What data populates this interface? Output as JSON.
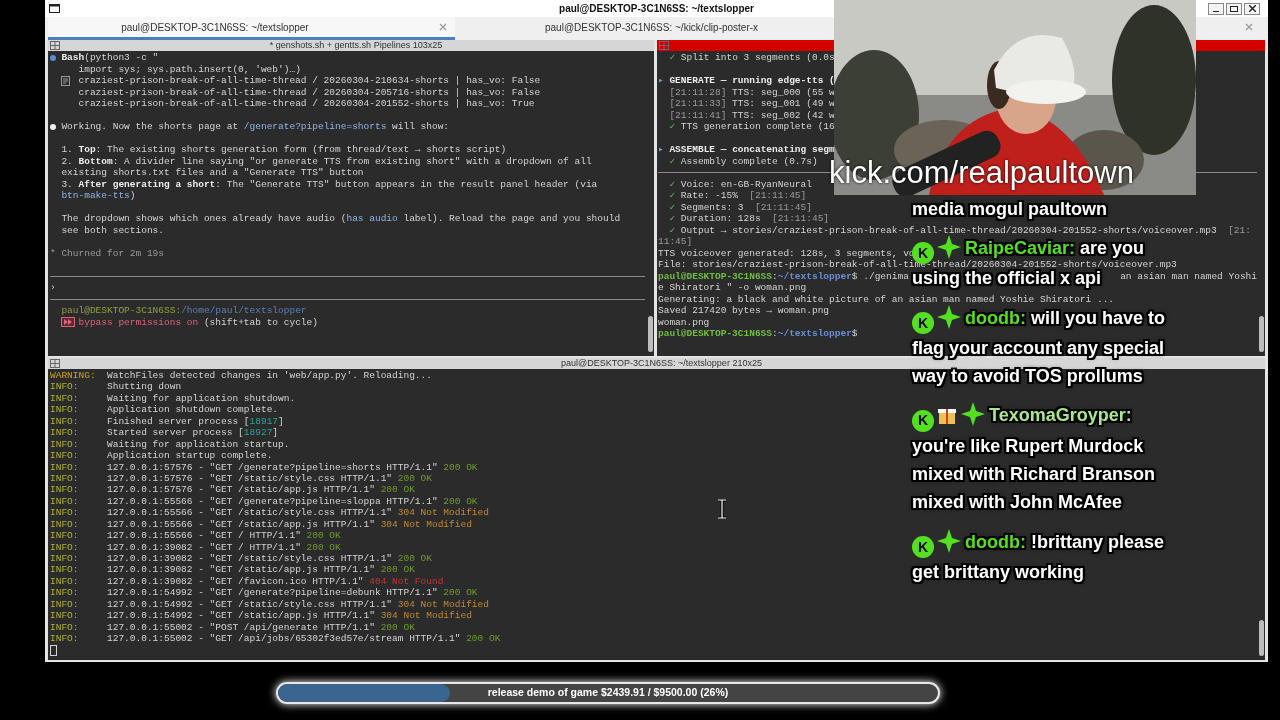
{
  "window": {
    "title": "paul@DESKTOP-3C1N6SS: ~/textslopper"
  },
  "tabs": [
    {
      "label": "paul@DESKTOP-3C1N6SS: ~/textslopper",
      "selected": true
    },
    {
      "label": "paul@DESKTOP-3C1N6SS: ~/kick/clip-poster-x",
      "selected": false
    },
    {
      "selected": false
    }
  ],
  "left_pane": {
    "title": "* genshots.sh + gentts.sh Pipelines 103x25",
    "activity": false,
    "lines": [
      {
        "kind": "text",
        "marker": {
          "kind": "dot",
          "color": "#5b8dd6"
        },
        "segments": [
          {
            "text": "Bash",
            "kind": "bold"
          },
          {
            "text": "(python3 -c \"",
            "kind": "plain"
          }
        ]
      },
      {
        "kind": "text",
        "segments": [
          {
            "text": "   import sys; sys.path.insert(0, 'web')…)",
            "kind": "plain"
          }
        ]
      },
      {
        "kind": "text",
        "marker": {
          "kind": "result"
        },
        "segments": [
          {
            "text": "craziest-prison-break-of-all-time-thread / 20260304-210634-shorts | has_vo: False",
            "kind": "plain"
          }
        ]
      },
      {
        "kind": "text",
        "segments": [
          {
            "text": "   craziest-prison-break-of-all-time-thread / 20260304-205716-shorts | has_vo: False",
            "kind": "plain"
          }
        ]
      },
      {
        "kind": "text",
        "segments": [
          {
            "text": "   craziest-prison-break-of-all-time-thread / 20260304-201552-shorts | has_vo: True",
            "kind": "plain"
          }
        ]
      },
      {
        "kind": "blank"
      },
      {
        "kind": "text",
        "marker": {
          "kind": "dot",
          "color": "#f0f0f0"
        },
        "segments": [
          {
            "text": "Working. Now the shorts page at ",
            "kind": "plain"
          },
          {
            "text": "/generate?pipeline=shorts",
            "kind": "link"
          },
          {
            "text": " will show:",
            "kind": "plain"
          }
        ]
      },
      {
        "kind": "blank"
      },
      {
        "kind": "text",
        "segments": [
          {
            "text": "1. ",
            "kind": "plain"
          },
          {
            "text": "Top",
            "kind": "bold"
          },
          {
            "text": ": The existing shorts generation form (from thread/text → shorts script)",
            "kind": "plain"
          }
        ]
      },
      {
        "kind": "text",
        "segments": [
          {
            "text": "2. ",
            "kind": "plain"
          },
          {
            "text": "Bottom",
            "kind": "bold"
          },
          {
            "text": ": A divider line saying \"or generate TTS from existing short\" with a dropdown of all",
            "kind": "plain"
          }
        ]
      },
      {
        "kind": "text",
        "segments": [
          {
            "text": "existing shorts.txt files and a \"Generate TTS\" button",
            "kind": "plain"
          }
        ]
      },
      {
        "kind": "text",
        "segments": [
          {
            "text": "3. ",
            "kind": "plain"
          },
          {
            "text": "After generating a short",
            "kind": "bold"
          },
          {
            "text": ": The \"Generate TTS\" button appears in the result panel header (via",
            "kind": "plain"
          }
        ]
      },
      {
        "kind": "text",
        "segments": [
          {
            "text": "btn-make-tts",
            "kind": "link"
          },
          {
            "text": ")",
            "kind": "plain"
          }
        ]
      },
      {
        "kind": "blank"
      },
      {
        "kind": "text",
        "segments": [
          {
            "text": "The dropdown shows which ones already have audio (",
            "kind": "plain"
          },
          {
            "text": "has audio",
            "kind": "link"
          },
          {
            "text": " label). Reload the page and you should",
            "kind": "plain"
          }
        ]
      },
      {
        "kind": "text",
        "segments": [
          {
            "text": "see both sections.",
            "kind": "plain"
          }
        ]
      },
      {
        "kind": "blank"
      },
      {
        "kind": "text",
        "marker": {
          "kind": "glyph",
          "text": "*"
        },
        "segments": [
          {
            "text": "Churned for 2m 19s",
            "kind": "dim"
          }
        ]
      },
      {
        "kind": "blank"
      },
      {
        "kind": "rule"
      },
      {
        "kind": "prompt",
        "text": "›"
      },
      {
        "kind": "rule"
      },
      {
        "kind": "text",
        "segments": [
          {
            "text": "paul@DESKTOP-3C1N6SS:",
            "kind": "host"
          },
          {
            "text": "/home/paul/textslopper",
            "kind": "path"
          }
        ]
      },
      {
        "kind": "text",
        "marker": {
          "kind": "permissions"
        },
        "segments": [
          {
            "text": "bypass permissions on",
            "kind": "alert"
          },
          {
            "text": " (shift+tab to cycle)",
            "kind": "plain"
          }
        ]
      }
    ]
  },
  "right_pane": {
    "activity": true,
    "lines": [
      {
        "kind": "text",
        "segments": [
          {
            "text": "  ✓",
            "kind": "ok"
          },
          {
            "text": " Split into 3 segments (0.0s",
            "kind": "plain"
          }
        ]
      },
      {
        "kind": "blank"
      },
      {
        "kind": "text",
        "segments": [
          {
            "text": "▸ ",
            "kind": "accent"
          },
          {
            "text": "GENERATE — running edge-tts (",
            "kind": "bold"
          }
        ]
      },
      {
        "kind": "text",
        "segments": [
          {
            "text": "  [21:11:28]",
            "kind": "dim"
          },
          {
            "text": " TTS: seg_000 (55 w",
            "kind": "plain"
          }
        ]
      },
      {
        "kind": "text",
        "segments": [
          {
            "text": "  [21:11:33]",
            "kind": "dim"
          },
          {
            "text": " TTS: seg_001 (49 w",
            "kind": "plain"
          }
        ]
      },
      {
        "kind": "text",
        "segments": [
          {
            "text": "  [21:11:41]",
            "kind": "dim"
          },
          {
            "text": " TTS: seg_002 (42 w",
            "kind": "plain"
          }
        ]
      },
      {
        "kind": "text",
        "segments": [
          {
            "text": "  ✓",
            "kind": "ok"
          },
          {
            "text": " TTS generation complete (16",
            "kind": "plain"
          }
        ]
      },
      {
        "kind": "blank"
      },
      {
        "kind": "text",
        "segments": [
          {
            "text": "▸ ",
            "kind": "accent"
          },
          {
            "text": "ASSEMBLE — concatenating segm",
            "kind": "bold"
          }
        ]
      },
      {
        "kind": "text",
        "segments": [
          {
            "text": "  ✓",
            "kind": "ok"
          },
          {
            "text": " Assembly complete (0.7s)",
            "kind": "plain"
          }
        ]
      },
      {
        "kind": "rule"
      },
      {
        "kind": "text",
        "segments": [
          {
            "text": "  ✓",
            "kind": "ok"
          },
          {
            "text": " Voice: en-GB-RyanNeural",
            "kind": "plain"
          }
        ]
      },
      {
        "kind": "text",
        "segments": [
          {
            "text": "  ✓",
            "kind": "ok"
          },
          {
            "text": " Rate: -15%  ",
            "kind": "plain"
          },
          {
            "text": "[21:11:45]",
            "kind": "dim"
          }
        ]
      },
      {
        "kind": "text",
        "segments": [
          {
            "text": "  ✓",
            "kind": "ok"
          },
          {
            "text": " Segments: 3  ",
            "kind": "plain"
          },
          {
            "text": "[21:11:45]",
            "kind": "dim"
          }
        ]
      },
      {
        "kind": "text",
        "segments": [
          {
            "text": "  ✓",
            "kind": "ok"
          },
          {
            "text": " Duration: 128s  ",
            "kind": "plain"
          },
          {
            "text": "[21:11:45]",
            "kind": "dim"
          }
        ]
      },
      {
        "kind": "text",
        "segments": [
          {
            "text": "  ✓",
            "kind": "ok"
          },
          {
            "text": " Output → stories/craziest-prison-break-of-all-time-thread/20260304-201552-shorts/voiceover.mp3  ",
            "kind": "plain"
          },
          {
            "text": "[21:",
            "kind": "dim"
          }
        ]
      },
      {
        "kind": "text",
        "segments": [
          {
            "text": "11:45]",
            "kind": "dim"
          }
        ]
      },
      {
        "kind": "text",
        "segments": [
          {
            "text": "TTS voiceover generated: 128s, 3 segments, vo",
            "kind": "plain"
          }
        ]
      },
      {
        "kind": "text",
        "segments": [
          {
            "text": "File: stories/craziest-prison-break-of-all-time-thread/20260304-201552-shorts/voiceover.mp3",
            "kind": "plain"
          }
        ]
      },
      {
        "kind": "text",
        "segments": [
          {
            "text": "paul@DESKTOP-3C1N6SS",
            "kind": "prompt_host"
          },
          {
            "text": ":",
            "kind": "plain"
          },
          {
            "text": "~/textslopper",
            "kind": "prompt_path"
          },
          {
            "text": "$ ./genima",
            "kind": "plain"
          }
        ],
        "tail": "an asian man named Yoshi"
      },
      {
        "kind": "text",
        "segments": [
          {
            "text": "e Shiratori \" -o woman.png",
            "kind": "plain"
          }
        ]
      },
      {
        "kind": "text",
        "segments": [
          {
            "text": "Generating: a black and white picture of an asian man named Yoshie Shiratori ...",
            "kind": "plain"
          }
        ]
      },
      {
        "kind": "text",
        "segments": [
          {
            "text": "Saved 217420 bytes → woman.png",
            "kind": "plain"
          }
        ]
      },
      {
        "kind": "text",
        "segments": [
          {
            "text": "woman.png",
            "kind": "plain"
          }
        ]
      },
      {
        "kind": "text",
        "segments": [
          {
            "text": "paul@DESKTOP-3C1N6SS",
            "kind": "prompt_host"
          },
          {
            "text": ":",
            "kind": "plain"
          },
          {
            "text": "~/textslopper",
            "kind": "prompt_path"
          },
          {
            "text": "$",
            "kind": "plain"
          }
        ]
      }
    ]
  },
  "bottom_pane": {
    "title": "paul@DESKTOP-3C1N6SS: ~/textslopper 210x25",
    "activity": false,
    "cursor": true,
    "lines": [
      {
        "level": {
          "text": "WARNING:",
          "kind": "warn"
        },
        "segments": [
          {
            "text": "WatchFiles detected changes in 'web/app.py'. Reloading...",
            "kind": "plain"
          }
        ]
      },
      {
        "level": {
          "text": "INFO:",
          "kind": "info"
        },
        "segments": [
          {
            "text": "Shutting down",
            "kind": "plain"
          }
        ]
      },
      {
        "level": {
          "text": "INFO:",
          "kind": "info"
        },
        "segments": [
          {
            "text": "Waiting for application shutdown.",
            "kind": "plain"
          }
        ]
      },
      {
        "level": {
          "text": "INFO:",
          "kind": "info"
        },
        "segments": [
          {
            "text": "Application shutdown complete.",
            "kind": "plain"
          }
        ]
      },
      {
        "level": {
          "text": "INFO:",
          "kind": "info"
        },
        "segments": [
          {
            "text": "Finished server process [",
            "kind": "plain"
          },
          {
            "text": "18917",
            "kind": "pid"
          },
          {
            "text": "]",
            "kind": "plain"
          }
        ]
      },
      {
        "level": {
          "text": "INFO:",
          "kind": "info"
        },
        "segments": [
          {
            "text": "Started server process [",
            "kind": "plain"
          },
          {
            "text": "18927",
            "kind": "pid"
          },
          {
            "text": "]",
            "kind": "plain"
          }
        ]
      },
      {
        "level": {
          "text": "INFO:",
          "kind": "info"
        },
        "segments": [
          {
            "text": "Waiting for application startup.",
            "kind": "plain"
          }
        ]
      },
      {
        "level": {
          "text": "INFO:",
          "kind": "info"
        },
        "segments": [
          {
            "text": "Application startup complete.",
            "kind": "plain"
          }
        ]
      },
      {
        "level": {
          "text": "INFO:",
          "kind": "info"
        },
        "segments": [
          {
            "text": "127.0.0.1:57576 - \"GET /generate?pipeline=shorts HTTP/1.1\" ",
            "kind": "plain"
          },
          {
            "text": "200 OK",
            "kind": "status_ok"
          }
        ]
      },
      {
        "level": {
          "text": "INFO:",
          "kind": "info"
        },
        "segments": [
          {
            "text": "127.0.0.1:57576 - \"GET /static/style.css HTTP/1.1\" ",
            "kind": "plain"
          },
          {
            "text": "200 OK",
            "kind": "status_ok"
          }
        ]
      },
      {
        "level": {
          "text": "INFO:",
          "kind": "info"
        },
        "segments": [
          {
            "text": "127.0.0.1:57576 - \"GET /static/app.js HTTP/1.1\" ",
            "kind": "plain"
          },
          {
            "text": "200 OK",
            "kind": "status_ok"
          }
        ]
      },
      {
        "level": {
          "text": "INFO:",
          "kind": "info"
        },
        "segments": [
          {
            "text": "127.0.0.1:55566 - \"GET /generate?pipeline=sloppa HTTP/1.1\" ",
            "kind": "plain"
          },
          {
            "text": "200 OK",
            "kind": "status_ok"
          }
        ]
      },
      {
        "level": {
          "text": "INFO:",
          "kind": "info"
        },
        "segments": [
          {
            "text": "127.0.0.1:55566 - \"GET /static/style.css HTTP/1.1\" ",
            "kind": "plain"
          },
          {
            "text": "304 Not Modified",
            "kind": "notmod"
          }
        ]
      },
      {
        "level": {
          "text": "INFO:",
          "kind": "info"
        },
        "segments": [
          {
            "text": "127.0.0.1:55566 - \"GET /static/app.js HTTP/1.1\" ",
            "kind": "plain"
          },
          {
            "text": "304 Not Modified",
            "kind": "notmod"
          }
        ]
      },
      {
        "level": {
          "text": "INFO:",
          "kind": "info"
        },
        "segments": [
          {
            "text": "127.0.0.1:55566 - \"GET / HTTP/1.1\" ",
            "kind": "plain"
          },
          {
            "text": "200 OK",
            "kind": "status_ok"
          }
        ]
      },
      {
        "level": {
          "text": "INFO:",
          "kind": "info"
        },
        "segments": [
          {
            "text": "127.0.0.1:39082 - \"GET / HTTP/1.1\" ",
            "kind": "plain"
          },
          {
            "text": "200 OK",
            "kind": "status_ok"
          }
        ]
      },
      {
        "level": {
          "text": "INFO:",
          "kind": "info"
        },
        "segments": [
          {
            "text": "127.0.0.1:39082 - \"GET /static/style.css HTTP/1.1\" ",
            "kind": "plain"
          },
          {
            "text": "200 OK",
            "kind": "status_ok"
          }
        ]
      },
      {
        "level": {
          "text": "INFO:",
          "kind": "info"
        },
        "segments": [
          {
            "text": "127.0.0.1:39082 - \"GET /static/app.js HTTP/1.1\" ",
            "kind": "plain"
          },
          {
            "text": "200 OK",
            "kind": "status_ok"
          }
        ]
      },
      {
        "level": {
          "text": "INFO:",
          "kind": "info"
        },
        "segments": [
          {
            "text": "127.0.0.1:39082 - \"GET /favicon.ico HTTP/1.1\" ",
            "kind": "plain"
          },
          {
            "text": "404 Not Found",
            "kind": "notfound"
          }
        ]
      },
      {
        "level": {
          "text": "INFO:",
          "kind": "info"
        },
        "segments": [
          {
            "text": "127.0.0.1:54992 - \"GET /generate?pipeline=debunk HTTP/1.1\" ",
            "kind": "plain"
          },
          {
            "text": "200 OK",
            "kind": "status_ok"
          }
        ]
      },
      {
        "level": {
          "text": "INFO:",
          "kind": "info"
        },
        "segments": [
          {
            "text": "127.0.0.1:54992 - \"GET /static/style.css HTTP/1.1\" ",
            "kind": "plain"
          },
          {
            "text": "304 Not Modified",
            "kind": "notmod"
          }
        ]
      },
      {
        "level": {
          "text": "INFO:",
          "kind": "info"
        },
        "segments": [
          {
            "text": "127.0.0.1:54992 - \"GET /static/app.js HTTP/1.1\" ",
            "kind": "plain"
          },
          {
            "text": "304 Not Modified",
            "kind": "notmod"
          }
        ]
      },
      {
        "level": {
          "text": "INFO:",
          "kind": "info"
        },
        "segments": [
          {
            "text": "127.0.0.1:55002 - \"POST /api/generate HTTP/1.1\" ",
            "kind": "plain"
          },
          {
            "text": "200 OK",
            "kind": "status_ok"
          }
        ]
      },
      {
        "level": {
          "text": "INFO:",
          "kind": "info"
        },
        "segments": [
          {
            "text": "127.0.0.1:55002 - \"GET /api/jobs/65302f3ed57e/stream HTTP/1.1\" ",
            "kind": "plain"
          },
          {
            "text": "200 OK",
            "kind": "status_ok"
          }
        ]
      }
    ]
  },
  "webcam": {
    "kind": "picture",
    "caption": "kick.com/realpaultown"
  },
  "chat": [
    {
      "text": "media mogul paultown"
    },
    {
      "badges": [
        {
          "kind": "kick",
          "text": "K"
        },
        {
          "kind": "sparkle"
        }
      ],
      "user": "RaipeCaviar:",
      "color": "#53e020",
      "text": "are you using the official x api"
    },
    {
      "badges": [
        {
          "kind": "kick",
          "text": "K"
        },
        {
          "kind": "sparkle"
        }
      ],
      "user": "doodb:",
      "color": "#53e020",
      "text": "will you have to flag your account any special way to avoid TOS prollums"
    },
    {
      "badges": [
        {
          "kind": "kick",
          "text": "K"
        },
        {
          "kind": "gift"
        },
        {
          "kind": "sparkle"
        }
      ],
      "user": "TexomaGroyper:",
      "color": "#a8e88a",
      "text": "you're like Rupert Murdock mixed with Richard Branson mixed with John McAfee"
    },
    {
      "badges": [
        {
          "kind": "kick",
          "text": "K"
        },
        {
          "kind": "sparkle"
        }
      ],
      "user": "doodb:",
      "color": "#53e020",
      "text": "!brittany please get brittany working"
    }
  ],
  "goal": {
    "label": "release demo of game $2439.91 / $9500.00 (26%)",
    "level": 0.26
  }
}
